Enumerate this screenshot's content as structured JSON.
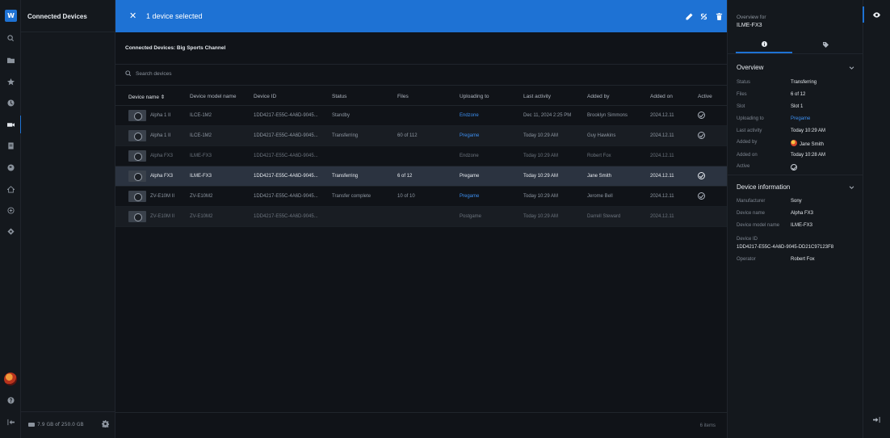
{
  "app": {
    "logo_letter": "W",
    "accent": "#1e72d4",
    "link_color": "#3d8ff0"
  },
  "rail": {
    "items": [
      "search-icon",
      "folder-icon",
      "star-icon",
      "clock-icon",
      "camera-icon",
      "document-icon",
      "globe-icon",
      "home-icon",
      "plus-circle-icon",
      "diamond-icon"
    ],
    "active": "camera-icon"
  },
  "left_panel": {
    "title": "Connected Devices",
    "storage": "7.9 GB of 250.0 GB"
  },
  "selection_bar": {
    "close_glyph": "✕",
    "label": "1 device selected",
    "actions": [
      "edit-icon",
      "unlink-icon",
      "delete-icon"
    ]
  },
  "main": {
    "breadcrumb": "Connected Devices: Big Sports Channel",
    "search_placeholder": "Search devices",
    "columns": [
      "Device name ⇕",
      "Device model name",
      "Device ID",
      "Status",
      "Files",
      "Uploading to",
      "Last activity",
      "Added by",
      "Added on",
      "Active"
    ],
    "rows": [
      {
        "name": "Alpha 1 II",
        "model": "ILCE-1M2",
        "id": "1DD4217-E55C-4A6D-9045...",
        "status": "Standby",
        "files": "",
        "uploading": "Endzone",
        "last": "Dec 11, 2024 2:25 PM",
        "added_by": "Brooklyn Simmons",
        "added_on": "2024.12.11",
        "active": true
      },
      {
        "name": "Alpha 1 II",
        "model": "ILCE-1M2",
        "id": "1DD4217-E55C-4A6D-9045...",
        "status": "Transferring",
        "files": "60 of 112",
        "uploading": "Pregame",
        "last": "Today 10:29 AM",
        "added_by": "Guy Hawkins",
        "added_on": "2024.12.11",
        "active": true
      },
      {
        "name": "Alpha FX3",
        "model": "ILME-FX3",
        "id": "1DD4217-E55C-4A6D-9045...",
        "status": "",
        "files": "",
        "uploading": "Endzone",
        "last": "Today 10:29 AM",
        "added_by": "Robert Fox",
        "added_on": "2024.12.11",
        "active": false
      },
      {
        "name": "Alpha FX3",
        "model": "ILME-FX3",
        "id": "1DD4217-E55C-4A6D-9045...",
        "status": "Transferring",
        "files": "6 of 12",
        "uploading": "Pregame",
        "last": "Today 10:29 AM",
        "added_by": "Jane Smith",
        "added_on": "2024.12.11",
        "active": true
      },
      {
        "name": "ZV-E10M II",
        "model": "ZV-E10M2",
        "id": "1DD4217-E55C-4A6D-9045...",
        "status": "Transfer complete",
        "files": "10 of 10",
        "uploading": "Pregame",
        "last": "Today 10:29 AM",
        "added_by": "Jerome Bell",
        "added_on": "2024.12.11",
        "active": true
      },
      {
        "name": "ZV-E10M II",
        "model": "ZV-E10M2",
        "id": "1DD4217-E55C-4A6D-9045...",
        "status": "",
        "files": "",
        "uploading": "Postgame",
        "last": "Today 10:29 AM",
        "added_by": "Darrell Steward",
        "added_on": "2024.12.11",
        "active": false
      }
    ],
    "item_count": "6 items"
  },
  "detail": {
    "overview_for": "Overview for",
    "device_name": "ILME-FX3",
    "overview_title": "Overview",
    "overview": [
      {
        "k": "Status",
        "v": "Transferring"
      },
      {
        "k": "Files",
        "v": "6 of 12"
      },
      {
        "k": "Slot",
        "v": "Slot 1"
      },
      {
        "k": "Uploading to",
        "v": "Pregame"
      },
      {
        "k": "Last activity",
        "v": "Today 10:29 AM"
      },
      {
        "k": "Added by",
        "v": "Jane Smith"
      },
      {
        "k": "Added on",
        "v": "Today 10:28 AM"
      },
      {
        "k": "Active",
        "v": ""
      }
    ],
    "info_title": "Device information",
    "info": [
      {
        "k": "Manufacturer",
        "v": "Sony"
      },
      {
        "k": "Device name",
        "v": "Alpha FX3"
      },
      {
        "k": "Device model name",
        "v": "ILME-FX3"
      },
      {
        "k": "Device ID",
        "v": ""
      }
    ],
    "device_id": "1DD4217-E55C-4A6D-9045-DD21C97123F8",
    "operator_label": "Operator",
    "operator_value": "Robert Fox"
  }
}
